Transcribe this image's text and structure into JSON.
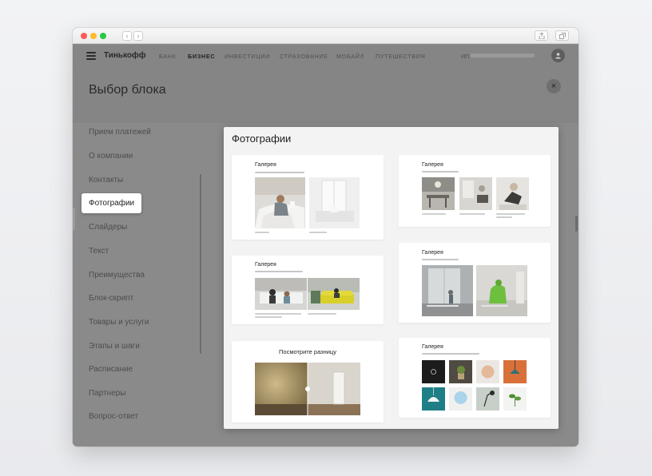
{
  "browser": {
    "back_glyph": "‹",
    "forward_glyph": "›",
    "icons": [
      "share-icon",
      "tabs-icon"
    ]
  },
  "topnav": {
    "brand": "Тинькофф",
    "items": [
      "БАНК",
      "БИЗНЕС",
      "ИНВЕСТИЦИИ",
      "СТРАХОВАНИЕ",
      "МОБАЙЛ",
      "ПУТЕШЕСТВИЯ"
    ],
    "active": "БИЗНЕС",
    "account_prefix": "ИП"
  },
  "header": {
    "title": "Выбор блока",
    "close_glyph": "×"
  },
  "categories": [
    "Прием платежей",
    "О компании",
    "Контакты",
    "Фотографии",
    "Слайдеры",
    "Текст",
    "Преимущества",
    "Блок-скрипт",
    "Товары и услуги",
    "Этапы и шаги",
    "Расписание",
    "Партнеры",
    "Вопрос-ответ"
  ],
  "active_category": "Фотографии",
  "panel": {
    "title": "Фотографии",
    "cards": [
      {
        "title": "Галерея"
      },
      {
        "title": "Галерея"
      },
      {
        "title": "Галерея"
      },
      {
        "title": "Галерея"
      },
      {
        "title": "Посмотрите разницу"
      },
      {
        "title": "Галерея"
      }
    ]
  },
  "colors": {
    "overlay": "#8a8a8a",
    "panel_bg": "#f3f3f3",
    "sofa_yellow": "#d9cf2a",
    "accent_orange": "#d9703a"
  }
}
